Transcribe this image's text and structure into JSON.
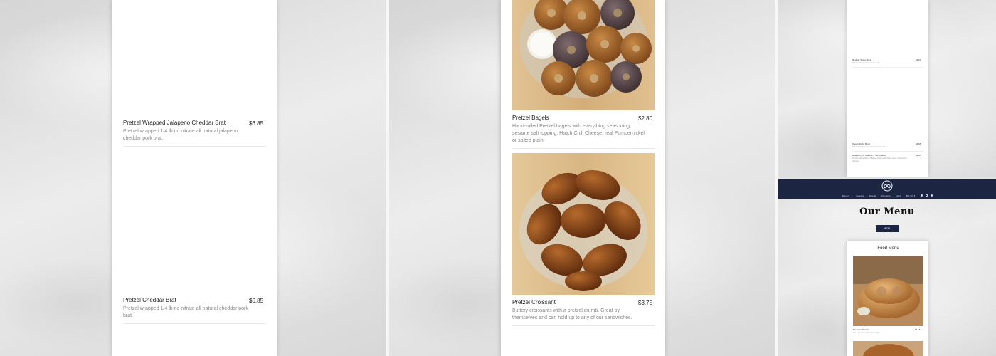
{
  "panel1": {
    "items": [
      {
        "name": "Pretzel Wrapped Jalapeno Cheddar Brat",
        "price": "$6.85",
        "desc_line1": "Pretzel wrapped 1/4 lb no nitrate all natural jalapeno",
        "desc_line2": "cheddar pork brat."
      },
      {
        "name": "Pretzel Cheddar Brat",
        "price": "$6.85",
        "desc_line1": "Pretzel wrapped 1/4 lb no nitrate all natural cheddar pork",
        "desc_line2": "brat."
      }
    ]
  },
  "panel2": {
    "items": [
      {
        "name": "Pretzel Bagels",
        "price": "$2.80",
        "desc_line1": "Hand-rolled Pretzel bagels with everything seasoning,",
        "desc_line2": "sesame salt topping, Hatch Chili Cheese, real Pumpernickel",
        "desc_line3": "or salted plain",
        "image": "bagels-photo"
      },
      {
        "name": "Pretzel Croissant",
        "price": "$3.75",
        "desc_line1": "Buttery croissants with a pretzel crumb. Great by",
        "desc_line2": "themselves and can hold up to any of our sandwiches.",
        "image": "croissants-photo"
      }
    ]
  },
  "panel3_top": {
    "items": [
      {
        "name": "Regular Sticky Buns",
        "price": "$4.00",
        "desc": "Hand-made cinnamon caramel roll"
      },
      {
        "name": "Pecan Sticky Buns",
        "price": "$4.95",
        "desc": "Hand-made pecan caramel cinnamon roll"
      },
      {
        "name": "Raspberry or Blueberry Sticky Buns",
        "price": "$4.95",
        "desc": "Hand-made raspberry filled roll topped with house glaze. Pretty flavor. delicious"
      }
    ]
  },
  "panel3_bottom": {
    "logo": "pretzel-logo",
    "nav": [
      "Menu ▾",
      "Catering",
      "Events",
      "Gift Cards",
      "Jobs",
      "Big Top ▾"
    ],
    "social_icons": [
      "facebook-icon",
      "instagram-icon",
      "share-icon"
    ],
    "page_title": "Our Menu",
    "menu_button": "MENU",
    "section_title": "Food Menu",
    "item": {
      "name": "Bavarian Pretzel",
      "price": "$4.15",
      "desc": "Our authentic, hand-rolled pretzel"
    }
  },
  "colors": {
    "navbar": "#1c2642",
    "menu_button": "#1c2642",
    "accent_text": "#222222"
  }
}
